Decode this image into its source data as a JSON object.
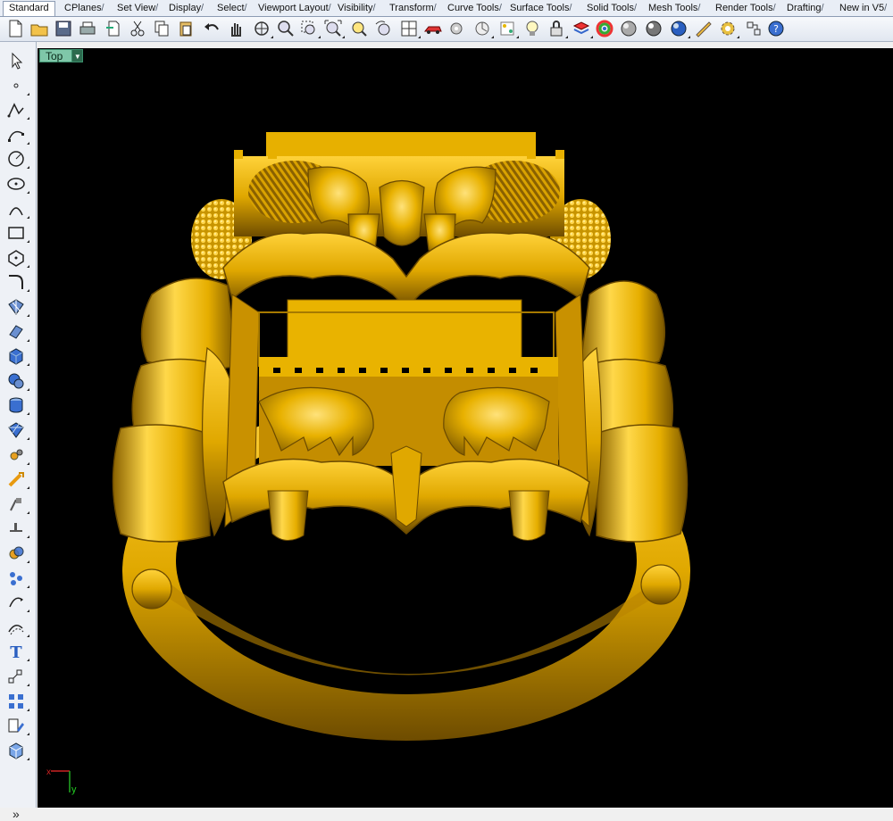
{
  "tabs": [
    {
      "label": "Standard"
    },
    {
      "label": "CPlanes"
    },
    {
      "label": "Set View"
    },
    {
      "label": "Display"
    },
    {
      "label": "Select"
    },
    {
      "label": "Viewport Layout"
    },
    {
      "label": "Visibility"
    },
    {
      "label": "Transform"
    },
    {
      "label": "Curve Tools"
    },
    {
      "label": "Surface Tools"
    },
    {
      "label": "Solid Tools"
    },
    {
      "label": "Mesh Tools"
    },
    {
      "label": "Render Tools"
    },
    {
      "label": "Drafting"
    },
    {
      "label": "New in V5"
    }
  ],
  "active_tab": "Standard",
  "toolbar_icons": [
    "new-file-icon",
    "open-folder-icon",
    "save-icon",
    "print-icon",
    "import-icon",
    "cut-icon",
    "copy-icon",
    "paste-icon",
    "undo-icon",
    "pan-hand-icon",
    "rotate-view-icon",
    "zoom-icon",
    "zoom-window-icon",
    "zoom-extents-icon",
    "zoom-selected-icon",
    "undo-view-icon",
    "viewport-layout-icon",
    "car-icon",
    "gear-lock-icon",
    "named-view-icon",
    "grid-snap-icon",
    "light-bulb-icon",
    "lock-icon",
    "layer-icon",
    "color-wheel-icon",
    "shaded-sphere-icon",
    "rendered-sphere-icon",
    "render-sphere-icon",
    "render-tools-icon",
    "options-gear-icon",
    "history-icon",
    "help-icon"
  ],
  "left_toolbar_icons": [
    "select-arrow-icon",
    "point-icon",
    "polyline-icon",
    "curve-icon",
    "circle-icon",
    "ellipse-icon",
    "arc-icon",
    "rectangle-icon",
    "polygon-icon",
    "curve-fillet-icon",
    "surface-icon",
    "extrude-icon",
    "box-solid-icon",
    "sphere-solid-icon",
    "cylinder-icon",
    "mesh-icon",
    "solid-tools-icon",
    "transform-icon",
    "split-icon",
    "trim-icon",
    "boolean-icon",
    "points-edit-icon",
    "curve-edit-icon",
    "offset-icon",
    "text-icon",
    "dimension-icon",
    "array-icon",
    "block-icon",
    "render-box-icon"
  ],
  "left_more": "»",
  "viewport": {
    "name": "Top",
    "axis_y_label": "y"
  },
  "colors": {
    "viewport_bg": "#000000",
    "model_gold": "#e8b100",
    "viewport_tab": "#7fc7a9"
  }
}
